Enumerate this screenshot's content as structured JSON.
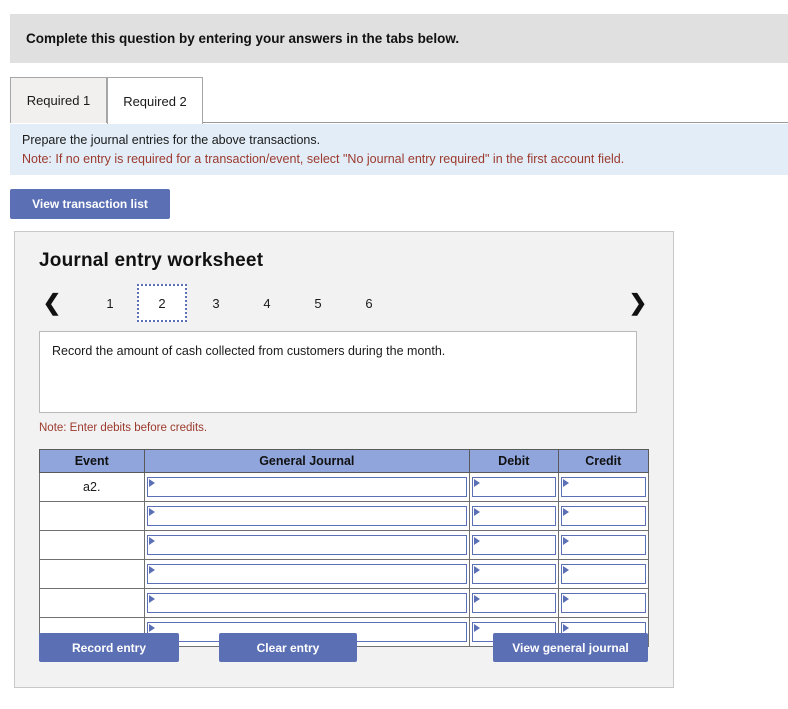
{
  "header": {
    "instruction": "Complete this question by entering your answers in the tabs below."
  },
  "tabs": [
    {
      "label": "Required 1",
      "active": false
    },
    {
      "label": "Required 2",
      "active": true
    }
  ],
  "note_banner": {
    "line1": "Prepare the journal entries for the above transactions.",
    "line2": "Note: If no entry is required for a transaction/event, select \"No journal entry required\" in the first account field."
  },
  "toolbar": {
    "view_transaction_list": "View transaction list"
  },
  "worksheet": {
    "title": "Journal entry worksheet",
    "pager": {
      "prev_icon": "chevron-left-icon",
      "next_icon": "chevron-right-icon",
      "prev_glyph": "❮",
      "next_glyph": "❯",
      "pages": [
        "1",
        "2",
        "3",
        "4",
        "5",
        "6"
      ],
      "selected": "2"
    },
    "description": "Record the amount of cash collected from customers during the month.",
    "debits_note": "Note: Enter debits before credits.",
    "table": {
      "columns": [
        "Event",
        "General Journal",
        "Debit",
        "Credit"
      ],
      "rows": [
        {
          "event": "a2.",
          "general_journal": "",
          "debit": "",
          "credit": ""
        },
        {
          "event": "",
          "general_journal": "",
          "debit": "",
          "credit": ""
        },
        {
          "event": "",
          "general_journal": "",
          "debit": "",
          "credit": ""
        },
        {
          "event": "",
          "general_journal": "",
          "debit": "",
          "credit": ""
        },
        {
          "event": "",
          "general_journal": "",
          "debit": "",
          "credit": ""
        },
        {
          "event": "",
          "general_journal": "",
          "debit": "",
          "credit": ""
        }
      ]
    },
    "actions": {
      "record_entry": "Record entry",
      "clear_entry": "Clear entry",
      "view_general_journal": "View general journal"
    }
  },
  "colors": {
    "button_blue": "#5b6fb5",
    "table_header_blue": "#8fa5dc",
    "banner_gray": "#e0e0e0",
    "note_banner_blue": "#e2edf7",
    "note_red": "#9c3a2e",
    "panel_gray": "#f2f2f2"
  }
}
